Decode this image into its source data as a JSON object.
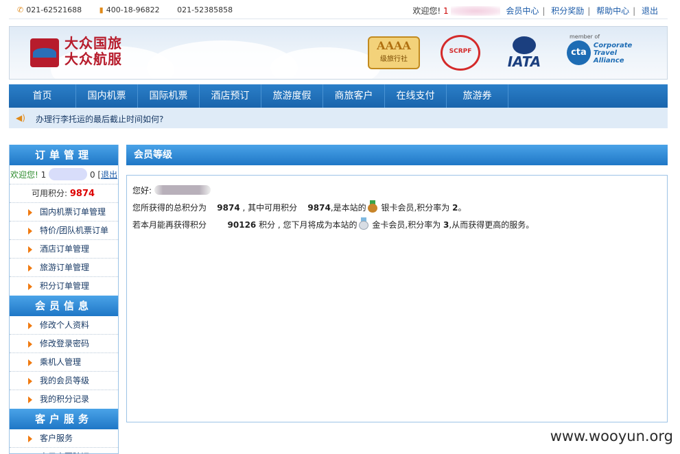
{
  "topbar": {
    "phone1": "021-62521688",
    "phone2": "400-18-96822",
    "phone3": "021-52385858",
    "welcome": "欢迎您!",
    "username_prefix": "1",
    "links": [
      "会员中心",
      "积分奖励",
      "帮助中心",
      "退出"
    ]
  },
  "banner": {
    "logo_line1": "大众国旅",
    "logo_line2": "大众航服",
    "aaaa": "AAAA",
    "aaaa_sub": "级旅行社",
    "scrpf": "SCRPF",
    "iata": "IATA",
    "cta_member": "member of",
    "cta_mark": "cta",
    "cta_line1": "Corporate Travel",
    "cta_line2": "Alliance"
  },
  "nav": [
    "首页",
    "国内机票",
    "国际机票",
    "酒店预订",
    "旅游度假",
    "商旅客户",
    "在线支付",
    "旅游券"
  ],
  "notice": {
    "text": "办理行李托运的最后截止时间如何?"
  },
  "sidebar": {
    "order_title": "订单管理",
    "welcome": "欢迎您!",
    "user_prefix": "1",
    "user_suffix": "0",
    "logout": "退出",
    "points_label": "可用积分:",
    "points_value": "9874",
    "order_items": [
      "国内机票订单管理",
      "特价/团队机票订单",
      "酒店订单管理",
      "旅游订单管理",
      "积分订单管理"
    ],
    "member_title": "会员信息",
    "member_items": [
      "修改个人资料",
      "修改登录密码",
      "乘机人管理",
      "我的会员等级",
      "我的积分记录"
    ],
    "service_title": "客户服务",
    "service_items": [
      "客户服务",
      "电子客票验证"
    ]
  },
  "main": {
    "title": "会员等级",
    "greeting": "您好:",
    "l2_a": "您所获得的总积分为",
    "l2_total": "9874",
    "l2_b": ",  其中可用积分",
    "l2_avail": "9874",
    "l2_c": ",是本站的",
    "l2_d": "银卡会员,积分率为",
    "l2_rate": "2",
    "l2_e": "。",
    "l3_a": "若本月能再获得积分",
    "l3_need": "90126",
    "l3_b": "积分 ,  您下月将成为本站的",
    "l3_c": "金卡会员,积分率为",
    "l3_rate": "3",
    "l3_d": ",从而获得更高的服务。"
  },
  "watermark": "www.wooyun.org"
}
